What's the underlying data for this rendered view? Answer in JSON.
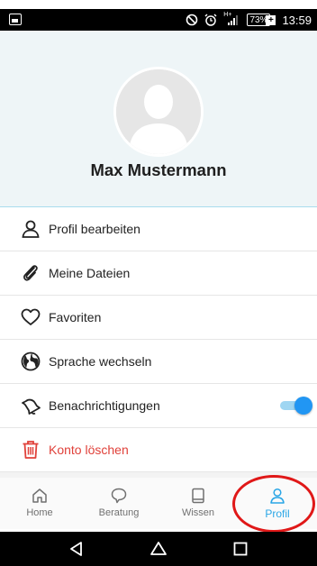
{
  "status_bar": {
    "battery": "73%",
    "time": "13:59",
    "icons": [
      "image-icon",
      "no-disturb-icon",
      "alarm-icon",
      "hplus-icon",
      "signal-icon",
      "battery-icon",
      "charging-icon"
    ],
    "network": "H+"
  },
  "profile": {
    "name": "Max Mustermann",
    "avatar_icon": "default-avatar-icon"
  },
  "menu": {
    "items": [
      {
        "label": "Profil bearbeiten",
        "icon": "user-icon"
      },
      {
        "label": "Meine Dateien",
        "icon": "paperclip-icon"
      },
      {
        "label": "Favoriten",
        "icon": "heart-icon"
      },
      {
        "label": "Sprache wechseln",
        "icon": "globe-icon"
      },
      {
        "label": "Benachrichtigungen",
        "icon": "bell-icon",
        "toggle": true
      },
      {
        "label": "Konto löschen",
        "icon": "trash-icon"
      }
    ]
  },
  "bottom_nav": {
    "tabs": [
      {
        "label": "Home",
        "icon": "home-icon"
      },
      {
        "label": "Beratung",
        "icon": "chat-icon"
      },
      {
        "label": "Wissen",
        "icon": "book-icon"
      },
      {
        "label": "Profil",
        "icon": "profile-icon"
      }
    ],
    "active": "Profil"
  },
  "colors": {
    "accent": "#2aa6e6",
    "toggle_on": "#2196f3",
    "danger": "#e0413a",
    "header_bg": "#eef5f7",
    "highlight": "#e01818"
  },
  "system_nav": {
    "icons": [
      "back-icon",
      "home-nav-icon",
      "recents-icon"
    ]
  }
}
